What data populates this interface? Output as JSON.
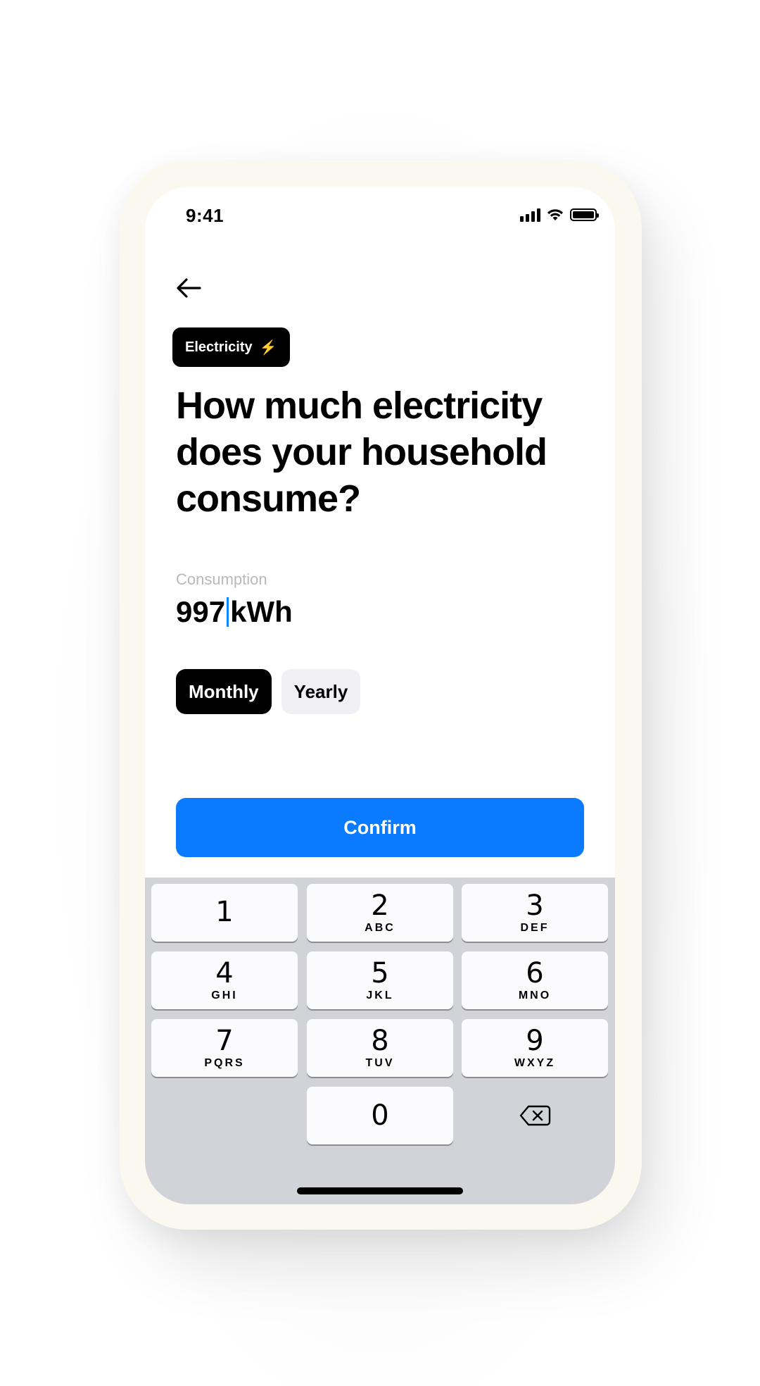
{
  "status_bar": {
    "time": "9:41",
    "icons": [
      "cellular-signal-icon",
      "wifi-icon",
      "battery-icon"
    ]
  },
  "nav": {
    "back_icon": "arrow-left-icon"
  },
  "badge": {
    "label": "Electricity",
    "emoji": "⚡"
  },
  "title": "How much electricity does your household consume?",
  "consumption": {
    "label": "Consumption",
    "value": "997",
    "unit": "kWh"
  },
  "period": {
    "options": [
      "Monthly",
      "Yearly"
    ],
    "selected": "Monthly"
  },
  "confirm_label": "Confirm",
  "keypad": {
    "keys": [
      {
        "num": "1",
        "letters": ""
      },
      {
        "num": "2",
        "letters": "ABC"
      },
      {
        "num": "3",
        "letters": "DEF"
      },
      {
        "num": "4",
        "letters": "GHI"
      },
      {
        "num": "5",
        "letters": "JKL"
      },
      {
        "num": "6",
        "letters": "MNO"
      },
      {
        "num": "7",
        "letters": "PQRS"
      },
      {
        "num": "8",
        "letters": "TUV"
      },
      {
        "num": "9",
        "letters": "WXYZ"
      },
      {
        "num": "0",
        "letters": ""
      }
    ],
    "backspace_icon": "backspace-icon"
  },
  "colors": {
    "accent": "#0a7aff",
    "caret": "#0a84ff",
    "badge_bg": "#000000",
    "keyboard_bg": "#d1d3d9"
  }
}
